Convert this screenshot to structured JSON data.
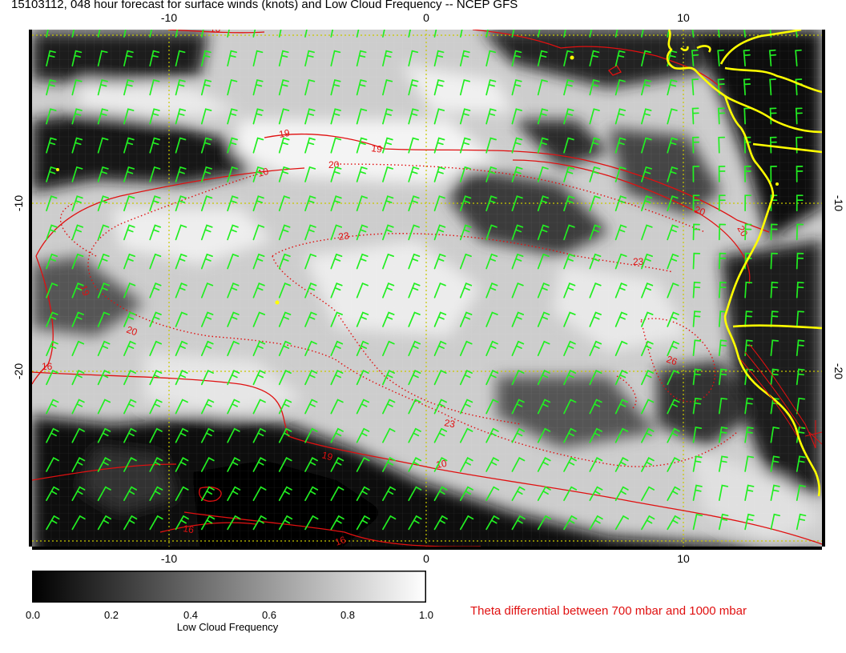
{
  "title": "15103112, 048 hour forecast for surface winds (knots) and Low Cloud Frequency -- NCEP GFS",
  "map": {
    "lon_ticks_top": [
      "-10",
      "0",
      "10"
    ],
    "lon_ticks_bottom": [
      "-10",
      "0",
      "10"
    ],
    "lat_ticks_left": [
      "-10",
      "-20"
    ],
    "lat_ticks_right": [
      "-10",
      "-20"
    ],
    "contour_labels": [
      "19",
      "19",
      "20",
      "10",
      "20",
      "23",
      "19",
      "20",
      "23",
      "26",
      "23",
      "19",
      "10",
      "16",
      "16",
      "16",
      "20",
      "10"
    ],
    "colors": {
      "wind_barbs": "#22ee22",
      "coastline": "#ffff00",
      "contours": "#e01010",
      "grid": "#c8c800"
    },
    "wind_direction": "southeasterly trades"
  },
  "colorbar": {
    "ticks": [
      "0.0",
      "0.2",
      "0.4",
      "0.6",
      "0.8",
      "1.0"
    ],
    "label": "Low Cloud Frequency",
    "min": 0.0,
    "max": 1.0
  },
  "theta_label": "Theta differential between 700 mbar and 1000 mbar"
}
